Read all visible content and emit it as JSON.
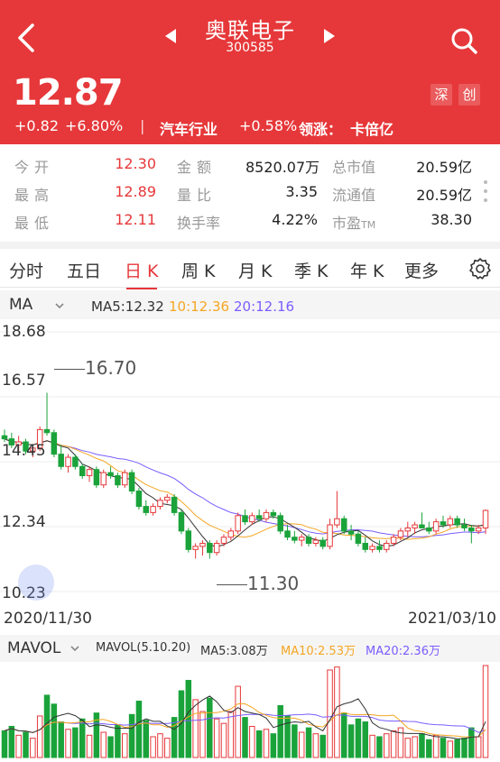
{
  "header": {
    "stock_name": "奥联电子",
    "stock_code": "300585",
    "price": "12.87",
    "change": "+0.82",
    "change_pct": "+6.80%",
    "separator": "|",
    "industry": "汽车行业",
    "industry_change": "+0.58%",
    "leader_label": "领涨：",
    "leader_name": "卡倍亿",
    "badge_market": "深",
    "badge_board": "创"
  },
  "stats": {
    "open_label": "今开",
    "open": "12.30",
    "high_label": "最高",
    "high": "12.89",
    "low_label": "最低",
    "low": "12.11",
    "amount_label": "金额",
    "amount": "8520.07万",
    "volratio_label": "量比",
    "volratio": "3.35",
    "turnover_label": "换手率",
    "turnover": "4.22%",
    "mktcap_label": "总市值",
    "mktcap": "20.59亿",
    "float_label": "流通值",
    "float": "20.59亿",
    "pe_label": "市盈",
    "pe_suffix": "TM",
    "pe": "38.30"
  },
  "tabs": [
    {
      "label": "分时"
    },
    {
      "label": "五日"
    },
    {
      "label": "日 K"
    },
    {
      "label": "周 K"
    },
    {
      "label": "月 K"
    },
    {
      "label": "季 K"
    },
    {
      "label": "年 K"
    },
    {
      "label": "更多"
    }
  ],
  "ma": {
    "selector": "MA",
    "ma5": "MA5:12.32",
    "ma10": "10:12.36",
    "ma20": "20:12.16"
  },
  "vol": {
    "selector": "MAVOL",
    "params": "MAVOL(5.10.20)",
    "ma5": "MA5:3.08万",
    "ma10": "MA10:2.53万",
    "ma20": "MA20:2.36万"
  },
  "colors": {
    "up": "#e6383a",
    "down": "#1aa33a",
    "ma5": "#333333",
    "ma10": "#f5a623",
    "ma20": "#7b5cff"
  },
  "chart_data": {
    "type": "candlestick",
    "y_ticks": [
      "18.68",
      "16.57",
      "14.45",
      "12.34",
      "10.23"
    ],
    "ylim": [
      10.23,
      18.68
    ],
    "x_start": "2020/11/30",
    "x_end": "2021/03/10",
    "max_annotation": "16.70",
    "min_annotation": "11.30",
    "candles": [
      [
        15.3,
        15.5,
        15.1,
        15.2
      ],
      [
        15.2,
        15.4,
        14.9,
        15.0
      ],
      [
        15.0,
        15.3,
        14.8,
        15.1
      ],
      [
        15.1,
        15.2,
        14.7,
        14.8
      ],
      [
        14.8,
        15.0,
        14.6,
        14.9
      ],
      [
        14.9,
        15.6,
        14.8,
        15.5
      ],
      [
        15.5,
        16.7,
        15.3,
        15.4
      ],
      [
        15.4,
        15.5,
        14.6,
        14.7
      ],
      [
        14.7,
        15.0,
        14.2,
        14.3
      ],
      [
        14.3,
        14.7,
        14.1,
        14.6
      ],
      [
        14.6,
        14.7,
        14.2,
        14.3
      ],
      [
        14.3,
        14.4,
        13.9,
        14.0
      ],
      [
        14.0,
        14.3,
        13.8,
        14.2
      ],
      [
        14.2,
        14.3,
        13.6,
        13.7
      ],
      [
        13.7,
        14.2,
        13.6,
        14.1
      ],
      [
        14.1,
        14.3,
        13.9,
        14.0
      ],
      [
        14.0,
        14.1,
        13.6,
        13.7
      ],
      [
        13.7,
        14.2,
        13.6,
        14.1
      ],
      [
        14.1,
        14.2,
        13.4,
        13.5
      ],
      [
        13.5,
        13.6,
        12.9,
        13.0
      ],
      [
        13.0,
        13.2,
        12.7,
        12.8
      ],
      [
        12.8,
        13.1,
        12.7,
        13.0
      ],
      [
        13.0,
        13.3,
        12.9,
        13.2
      ],
      [
        13.2,
        13.4,
        13.1,
        13.3
      ],
      [
        13.3,
        13.4,
        12.7,
        12.8
      ],
      [
        12.8,
        12.9,
        12.1,
        12.2
      ],
      [
        12.2,
        12.3,
        11.5,
        11.6
      ],
      [
        11.6,
        11.8,
        11.3,
        11.7
      ],
      [
        11.7,
        11.9,
        11.4,
        11.8
      ],
      [
        11.8,
        11.9,
        11.3,
        11.5
      ],
      [
        11.5,
        11.9,
        11.4,
        11.8
      ],
      [
        11.8,
        12.1,
        11.7,
        12.0
      ],
      [
        12.0,
        12.3,
        11.9,
        12.2
      ],
      [
        12.2,
        12.8,
        12.1,
        12.7
      ],
      [
        12.7,
        12.9,
        12.4,
        12.5
      ],
      [
        12.5,
        12.8,
        12.4,
        12.7
      ],
      [
        12.7,
        12.9,
        12.5,
        12.6
      ],
      [
        12.6,
        12.9,
        12.5,
        12.8
      ],
      [
        12.8,
        12.9,
        12.6,
        12.7
      ],
      [
        12.7,
        12.8,
        12.1,
        12.2
      ],
      [
        12.2,
        12.4,
        11.9,
        12.0
      ],
      [
        12.0,
        12.2,
        11.8,
        11.9
      ],
      [
        11.9,
        12.1,
        11.7,
        12.0
      ],
      [
        12.0,
        12.1,
        11.7,
        11.8
      ],
      [
        11.8,
        12.0,
        11.7,
        11.9
      ],
      [
        11.9,
        12.0,
        11.6,
        11.7
      ],
      [
        11.7,
        12.6,
        11.6,
        12.4
      ],
      [
        12.4,
        13.5,
        12.3,
        12.6
      ],
      [
        12.6,
        12.7,
        12.1,
        12.2
      ],
      [
        12.2,
        12.4,
        11.9,
        12.1
      ],
      [
        12.1,
        12.2,
        11.7,
        11.8
      ],
      [
        11.8,
        12.0,
        11.5,
        11.6
      ],
      [
        11.6,
        11.8,
        11.5,
        11.7
      ],
      [
        11.7,
        11.9,
        11.5,
        11.6
      ],
      [
        11.6,
        11.9,
        11.5,
        11.8
      ],
      [
        11.8,
        12.1,
        11.7,
        12.0
      ],
      [
        12.0,
        12.3,
        11.9,
        12.2
      ],
      [
        12.2,
        12.5,
        12.0,
        12.3
      ],
      [
        12.3,
        12.5,
        12.1,
        12.4
      ],
      [
        12.4,
        12.8,
        12.3,
        12.3
      ],
      [
        12.3,
        12.5,
        12.1,
        12.2
      ],
      [
        12.2,
        12.6,
        12.1,
        12.5
      ],
      [
        12.5,
        12.7,
        12.3,
        12.4
      ],
      [
        12.4,
        12.7,
        12.3,
        12.6
      ],
      [
        12.6,
        12.7,
        12.3,
        12.4
      ],
      [
        12.4,
        12.6,
        12.2,
        12.3
      ],
      [
        12.3,
        12.4,
        11.8,
        12.2
      ],
      [
        12.2,
        12.4,
        12.1,
        12.3
      ],
      [
        12.3,
        12.9,
        12.1,
        12.87
      ]
    ],
    "volume_wan": [
      1.8,
      2.1,
      1.5,
      1.7,
      1.3,
      2.8,
      4.2,
      3.6,
      2.4,
      1.9,
      2.0,
      2.6,
      1.5,
      3.0,
      1.7,
      1.4,
      2.2,
      1.6,
      2.9,
      3.8,
      2.5,
      1.4,
      1.6,
      1.3,
      2.7,
      4.5,
      5.2,
      3.9,
      3.1,
      4.0,
      2.6,
      2.3,
      3.1,
      4.8,
      2.7,
      2.1,
      1.8,
      1.9,
      1.6,
      3.5,
      2.8,
      2.2,
      1.7,
      2.0,
      1.6,
      1.5,
      5.9,
      6.1,
      3.0,
      2.2,
      2.6,
      2.4,
      1.5,
      1.4,
      1.6,
      1.8,
      2.0,
      1.3,
      1.4,
      1.6,
      1.2,
      1.5,
      1.3,
      1.1,
      1.2,
      1.3,
      2.0,
      1.4,
      6.2
    ]
  }
}
